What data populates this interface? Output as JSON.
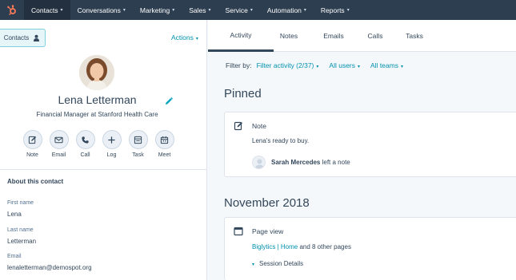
{
  "colors": {
    "nav_bg": "#2d3e50",
    "accent": "#0091ae",
    "logo": "#ff7a59",
    "text": "#33475b"
  },
  "nav": {
    "logo_icon": "sprocket-icon",
    "items": [
      {
        "label": "Contacts",
        "active": true
      },
      {
        "label": "Conversations"
      },
      {
        "label": "Marketing"
      },
      {
        "label": "Sales"
      },
      {
        "label": "Service"
      },
      {
        "label": "Automation"
      },
      {
        "label": "Reports"
      }
    ]
  },
  "left": {
    "back_button": "Contacts",
    "actions_label": "Actions",
    "contact": {
      "name": "Lena Letterman",
      "title": "Financial Manager at Stanford Health Care"
    },
    "actions": [
      {
        "label": "Note",
        "icon": "note-icon"
      },
      {
        "label": "Email",
        "icon": "email-icon"
      },
      {
        "label": "Call",
        "icon": "phone-icon"
      },
      {
        "label": "Log",
        "icon": "plus-icon"
      },
      {
        "label": "Task",
        "icon": "task-icon"
      },
      {
        "label": "Meet",
        "icon": "calendar-icon"
      }
    ],
    "about": {
      "title": "About this contact",
      "fields": [
        {
          "label": "First name",
          "value": "Lena"
        },
        {
          "label": "Last name",
          "value": "Letterman"
        },
        {
          "label": "Email",
          "value": "lenaletterman@demospot.org"
        }
      ]
    }
  },
  "tabs": [
    "Activity",
    "Notes",
    "Emails",
    "Calls",
    "Tasks"
  ],
  "filter": {
    "label": "Filter by:",
    "activity": "Filter activity (2/37)",
    "users": "All users",
    "teams": "All teams"
  },
  "pinned": {
    "heading": "Pinned",
    "note_title": "Note",
    "note_body": "Lena's ready to buy.",
    "author": "Sarah Mercedes",
    "author_suffix": "left a note"
  },
  "timeline": {
    "heading": "November 2018",
    "page_view_title": "Page view",
    "link_site": "Biglytics",
    "link_sep": " | ",
    "link_page": "Home",
    "link_suffix": " and 8 other pages",
    "details_label": "Session Details"
  }
}
